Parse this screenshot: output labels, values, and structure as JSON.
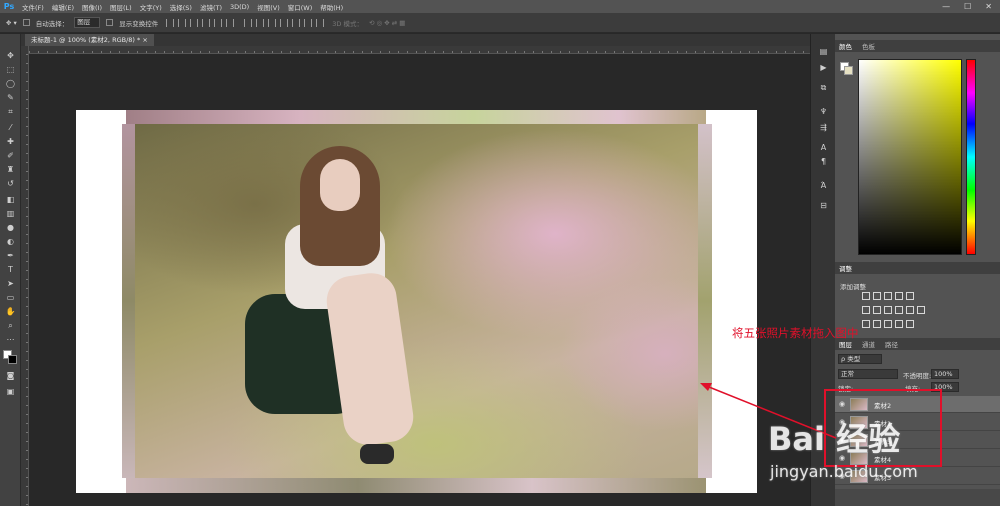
{
  "app": {
    "logo": "Ps"
  },
  "menu": [
    "文件(F)",
    "编辑(E)",
    "图像(I)",
    "图层(L)",
    "文字(Y)",
    "选择(S)",
    "滤镜(T)",
    "3D(D)",
    "视图(V)",
    "窗口(W)",
    "帮助(H)"
  ],
  "window_controls": {
    "minimize": "—",
    "maximize": "☐",
    "close": "✕"
  },
  "options": {
    "auto_select_label": "自动选择：",
    "auto_select_value": "图层",
    "show_transform_label": "显示变换控件",
    "mode_3d_label": "3D 模式："
  },
  "document": {
    "tab_title": "未标题-1 @ 100% (素材2, RGB/8) *",
    "close": "×"
  },
  "color_panel": {
    "tab_color": "颜色",
    "tab_swatches": "色板"
  },
  "adjustments": {
    "tab": "调整",
    "add_label": "添加调整"
  },
  "layers_panel": {
    "tab_layers": "图层",
    "tab_channels": "通道",
    "tab_paths": "路径",
    "filter": "ρ 类型",
    "blend_mode": "正常",
    "opacity_label": "不透明度:",
    "opacity_value": "100%",
    "lock_label": "锁定:",
    "fill_label": "填充:",
    "fill_value": "100%",
    "layers": [
      {
        "name": "素材2",
        "selected": true
      },
      {
        "name": "素材1",
        "selected": false
      },
      {
        "name": "素材5",
        "selected": false
      },
      {
        "name": "素材4",
        "selected": false
      },
      {
        "name": "素材3",
        "selected": false
      }
    ]
  },
  "annotation": {
    "text": "将五张照片素材拖入图中"
  },
  "watermark": {
    "logo": "Bai 经验",
    "url": "jingyan.baidu.com"
  },
  "colors": {
    "annotation_red": "#e0102a",
    "ps_blue": "#31a8ff",
    "panel_bg": "#535353",
    "workspace_bg": "#282828"
  }
}
